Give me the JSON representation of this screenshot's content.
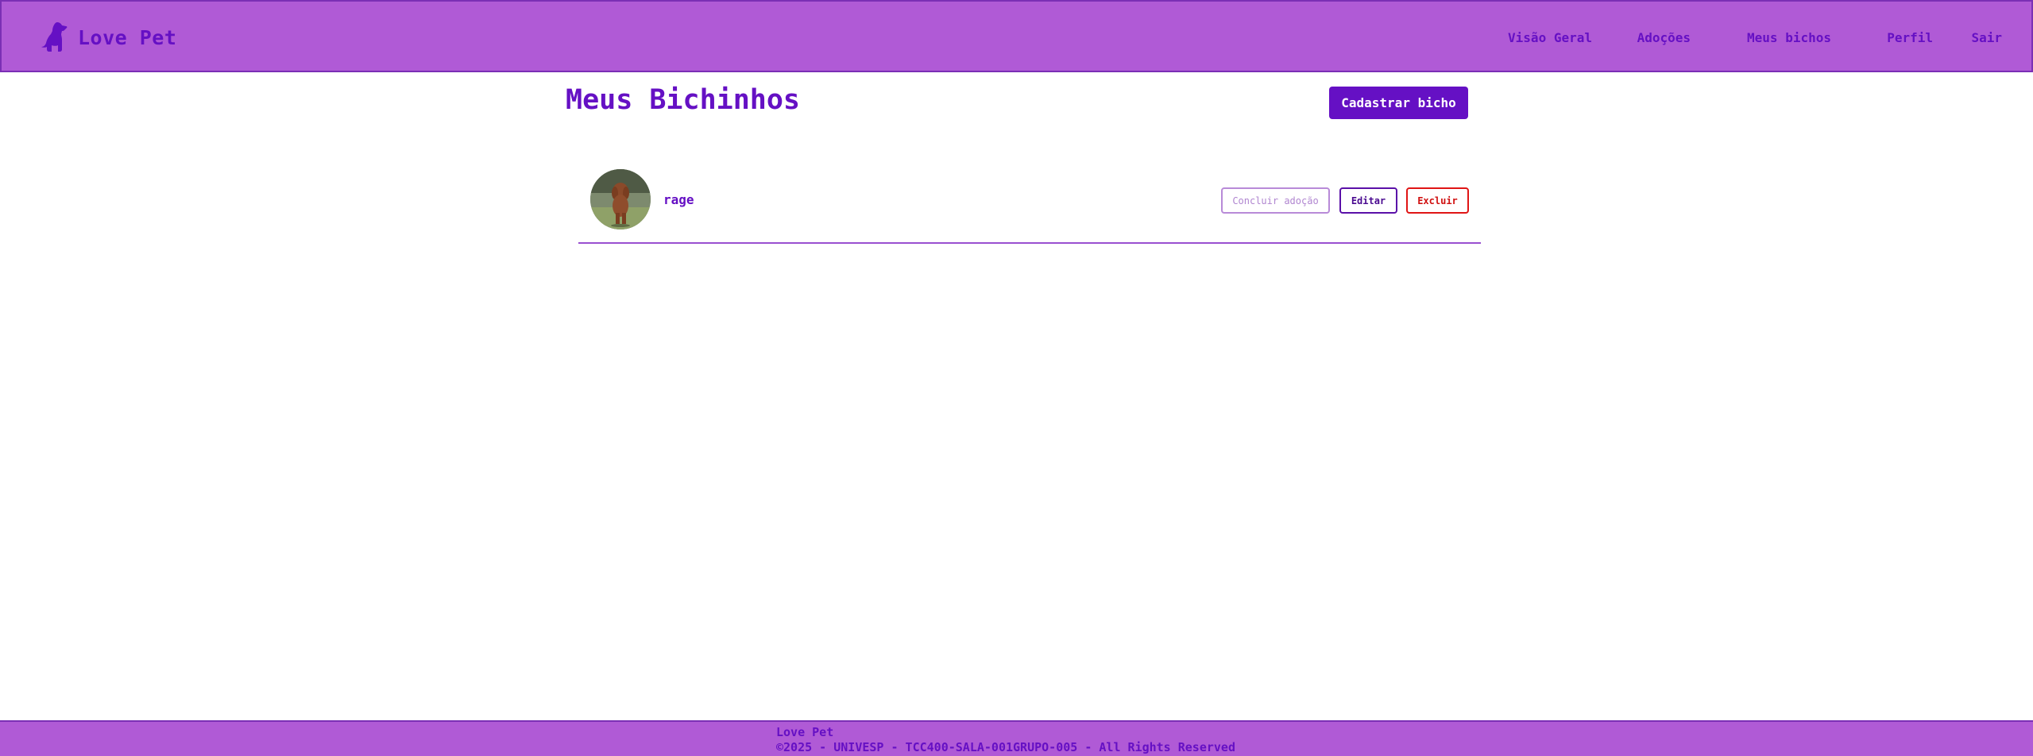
{
  "header": {
    "brand": "Love Pet",
    "brand_icon": "dog-icon",
    "nav": [
      {
        "label": "Visão Geral"
      },
      {
        "label": "Adoções"
      },
      {
        "label": "Meus bichos"
      },
      {
        "label": "Perfil"
      },
      {
        "label": "Sair"
      }
    ]
  },
  "main": {
    "title": "Meus Bichinhos",
    "add_button": "Cadastrar bicho",
    "pets": [
      {
        "name": "rage",
        "photo_icon": "pet-photo",
        "actions": {
          "conclude": "Concluir adoção",
          "edit": "Editar",
          "delete": "Excluir"
        }
      }
    ]
  },
  "footer": {
    "brand": "Love Pet",
    "copyright": "©2025 - UNIVESP - TCC400-SALA-001GRUPO-005 - All Rights Reserved"
  },
  "colors": {
    "header_bg": "#b05ad6",
    "accent": "#6510c4",
    "danger": "#e01515"
  }
}
